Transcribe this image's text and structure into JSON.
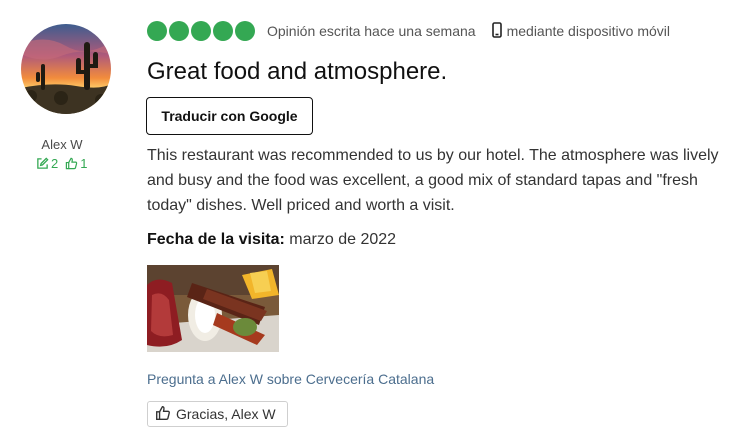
{
  "user": {
    "name": "Alex W",
    "contributions": "2",
    "helpful_votes": "1",
    "avatar": "desert-sunset-cactus"
  },
  "review": {
    "rating": 5,
    "rating_max": 5,
    "written_text": "Opinión escrita hace una semana",
    "device_icon": "mobile-phone-icon",
    "device_text": "mediante dispositivo móvil",
    "title": "Great food and atmosphere.",
    "translate_label": "Traducir con Google",
    "body": "This restaurant was recommended to us by our hotel. The atmosphere was lively and busy and the food was excellent, a good mix of standard tapas and \"fresh today\" dishes. Well priced and worth a visit.",
    "visit_label": "Fecha de la visita:",
    "visit_date": "marzo de 2022",
    "photo": "tapas-plate-photo",
    "ask_link": "Pregunta a Alex W sobre Cervecería Catalana",
    "thanks_label": "Gracias, Alex W"
  },
  "colors": {
    "bubble": "#34a853",
    "link": "#4c6e8e",
    "text": "#333333"
  }
}
